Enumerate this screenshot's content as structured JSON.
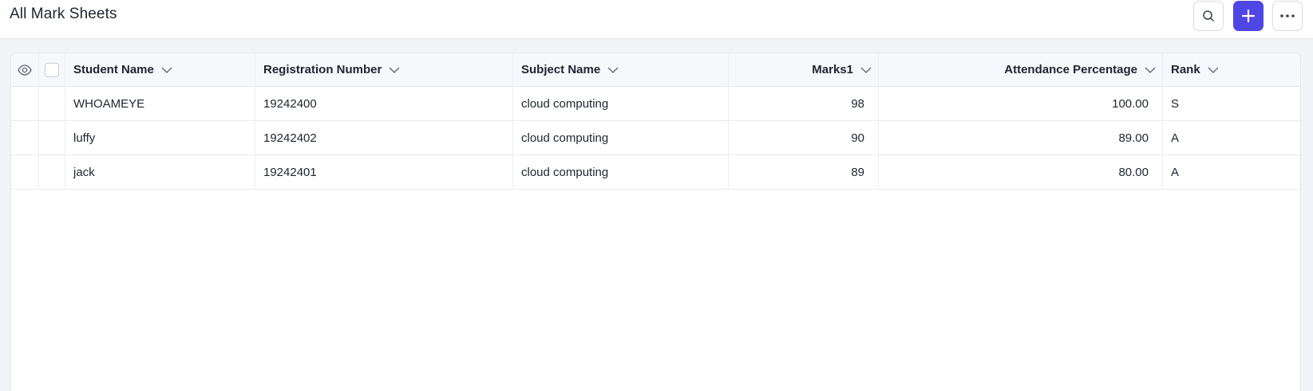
{
  "page": {
    "title": "All Mark Sheets"
  },
  "toolbar": {
    "search_icon": "search-icon",
    "add_icon": "plus-icon",
    "more_icon": "more-horizontal-icon",
    "accent_color": "#4f46e5"
  },
  "table": {
    "columns": [
      {
        "label": "Student Name"
      },
      {
        "label": "Registration Number"
      },
      {
        "label": "Subject Name"
      },
      {
        "label": "Marks1"
      },
      {
        "label": "Attendance Percentage"
      },
      {
        "label": "Rank"
      }
    ],
    "rows": [
      {
        "student_name": "WHOAMEYE",
        "registration_number": "19242400",
        "subject_name": "cloud computing",
        "marks1": "98",
        "attendance": "100.00",
        "rank": "S"
      },
      {
        "student_name": "luffy",
        "registration_number": "19242402",
        "subject_name": "cloud computing",
        "marks1": "90",
        "attendance": "89.00",
        "rank": "A"
      },
      {
        "student_name": "jack",
        "registration_number": "19242401",
        "subject_name": "cloud computing",
        "marks1": "89",
        "attendance": "80.00",
        "rank": "A"
      }
    ]
  }
}
